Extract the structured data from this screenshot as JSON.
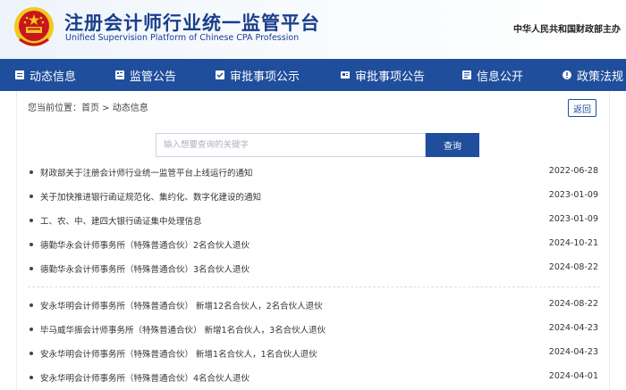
{
  "header": {
    "title": "注册会计师行业统一监管平台",
    "subtitle": "Unified Supervision Platform of Chinese CPA Profession",
    "ministry": "中华人民共和国财政部主办"
  },
  "nav": {
    "items": [
      {
        "label": "动态信息",
        "icon": "document-icon"
      },
      {
        "label": "监管公告",
        "icon": "bulletin-icon"
      },
      {
        "label": "审批事项公示",
        "icon": "approval-icon"
      },
      {
        "label": "审批事项公告",
        "icon": "announcement-icon"
      },
      {
        "label": "信息公开",
        "icon": "info-icon"
      },
      {
        "label": "政策法规",
        "icon": "policy-icon"
      }
    ]
  },
  "breadcrumb": "您当前位置：首页 > 动态信息",
  "back_label": "返回",
  "search": {
    "placeholder": "输入想要查询的关键字",
    "button_label": "查询"
  },
  "news": [
    {
      "title": "财政部关于注册会计师行业统一监管平台上线运行的通知",
      "date": "2022-06-28"
    },
    {
      "title": "关于加快推进银行函证规范化、集约化、数字化建设的通知",
      "date": "2023-01-09"
    },
    {
      "title": "工、农、中、建四大银行函证集中处理信息",
      "date": "2023-01-09"
    },
    {
      "title": "德勤华永会计师事务所（特殊普通合伙）2名合伙人退伙",
      "date": "2024-10-21"
    },
    {
      "title": "德勤华永会计师事务所（特殊普通合伙）3名合伙人退伙",
      "date": "2024-08-22"
    },
    {
      "title": "安永华明会计师事务所（特殊普通合伙） 新增12名合伙人，2名合伙人退伙",
      "date": "2024-08-22"
    },
    {
      "title": "毕马威华振会计师事务所（特殊普通合伙） 新增1名合伙人，3名合伙人退伙",
      "date": "2024-04-23"
    },
    {
      "title": "安永华明会计师事务所（特殊普通合伙） 新增1名合伙人，1名合伙人退伙",
      "date": "2024-04-23"
    },
    {
      "title": "安永华明会计师事务所（特殊普通合伙）4名合伙人退伙",
      "date": "2024-04-01"
    }
  ],
  "colors": {
    "nav_bg": "#1f4e9c",
    "title": "#1a3e8c",
    "emblem_red": "#c8161d",
    "emblem_gold": "#f3c623"
  }
}
